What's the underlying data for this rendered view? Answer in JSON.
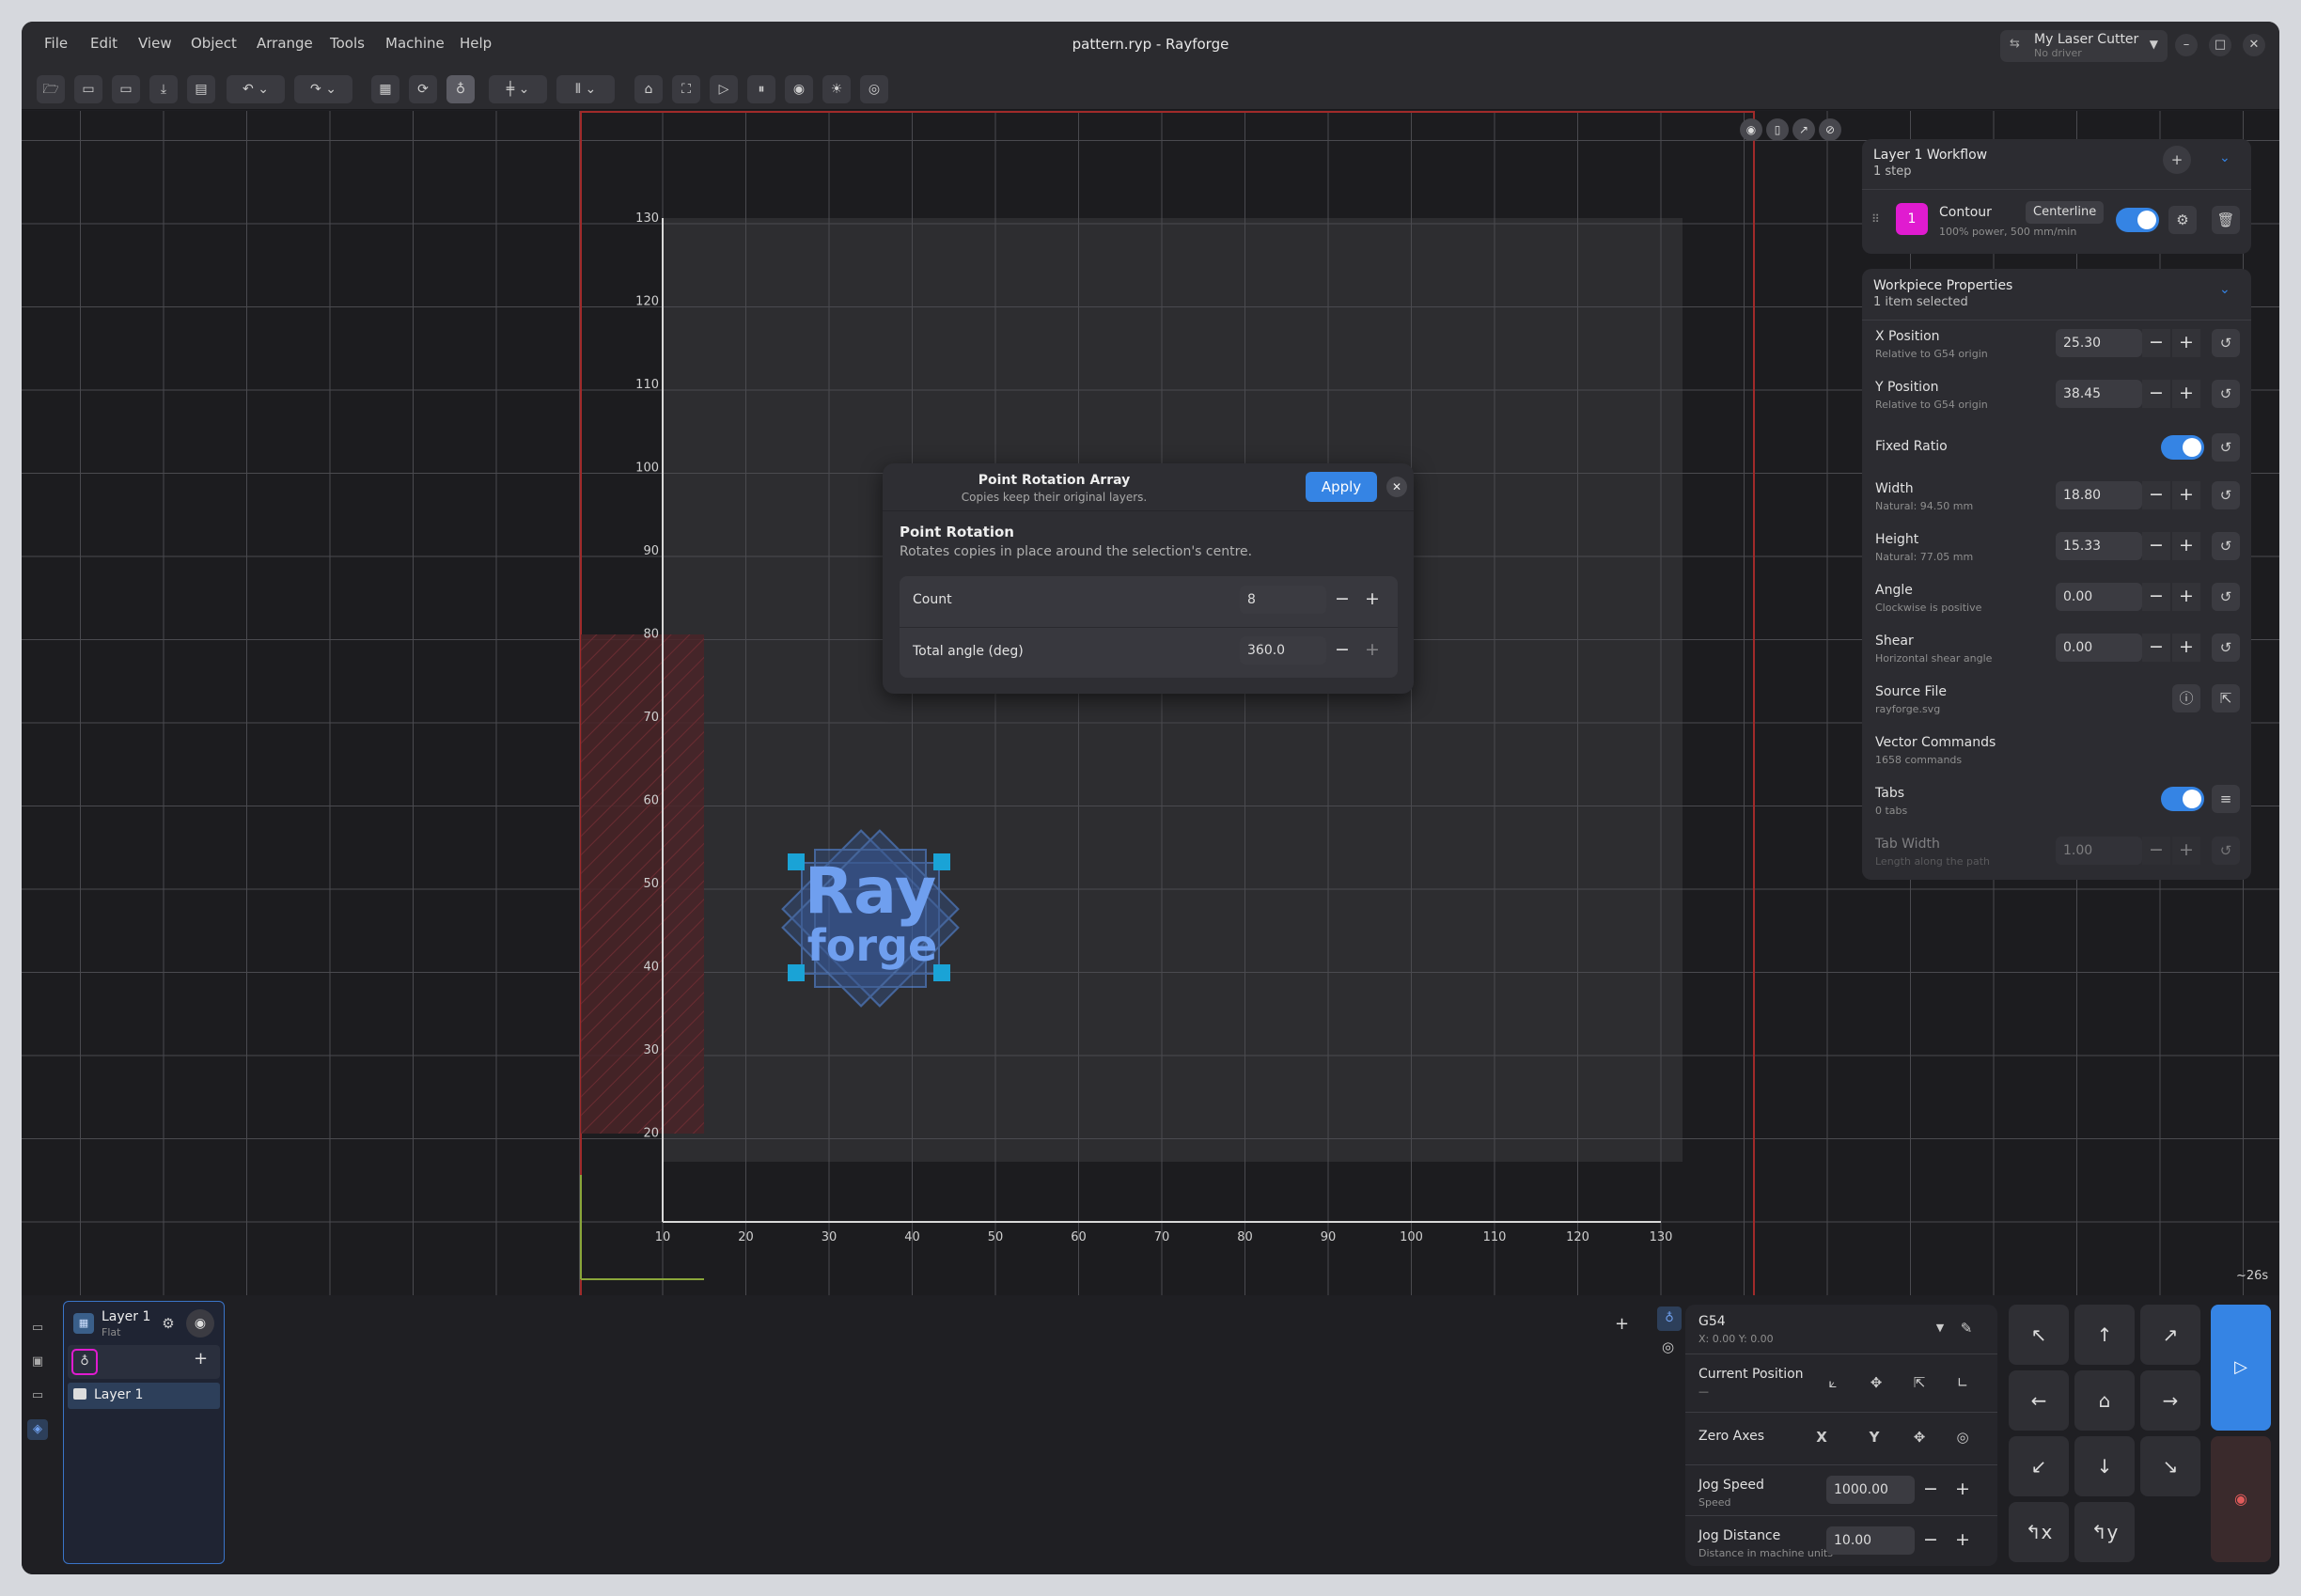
{
  "window": {
    "title": "pattern.ryp - Rayforge",
    "machine_name": "My Laser Cutter",
    "machine_driver": "No driver"
  },
  "menu": [
    "File",
    "Edit",
    "View",
    "Object",
    "Arrange",
    "Tools",
    "Machine",
    "Help"
  ],
  "toolbar_icons": [
    "open-icon",
    "save-icon",
    "save-as-icon",
    "import-icon",
    "export-icon",
    "undo-icon",
    "undo-menu-icon",
    "redo-icon",
    "redo-menu-icon",
    "gcode-icon",
    "refresh-icon",
    "travel-icon",
    "align-icon",
    "align-menu-icon",
    "distribute-icon",
    "distribute-menu-icon",
    "home-icon",
    "frame-icon",
    "send-icon",
    "pause-icon",
    "stop-icon",
    "focus-icon",
    "target-icon"
  ],
  "canvas": {
    "x_ticks": [
      "10",
      "20",
      "30",
      "40",
      "50",
      "60",
      "70",
      "80",
      "90",
      "100",
      "110",
      "120",
      "130"
    ],
    "y_ticks": [
      "130",
      "120",
      "110",
      "100",
      "90",
      "80",
      "70",
      "60",
      "50",
      "40",
      "30",
      "20"
    ],
    "time_estimate": "~26s",
    "logo_line1": "Ray",
    "logo_line2": "forge"
  },
  "workflow": {
    "title": "Layer 1 Workflow",
    "subtitle": "1 step",
    "step_number": "1",
    "step_name": "Contour",
    "step_badge": "Centerline",
    "step_detail": "100% power, 500 mm/min",
    "step_color": "#e01bd0"
  },
  "props": {
    "title": "Workpiece Properties",
    "subtitle": "1 item selected",
    "x_label": "X Position",
    "x_sub": "Relative to G54 origin",
    "x_val": "25.30",
    "y_label": "Y Position",
    "y_sub": "Relative to G54 origin",
    "y_val": "38.45",
    "ratio_label": "Fixed Ratio",
    "w_label": "Width",
    "w_sub": "Natural: 94.50 mm",
    "w_val": "18.80",
    "h_label": "Height",
    "h_sub": "Natural: 77.05 mm",
    "h_val": "15.33",
    "a_label": "Angle",
    "a_sub": "Clockwise is positive",
    "a_val": "0.00",
    "s_label": "Shear",
    "s_sub": "Horizontal shear angle",
    "s_val": "0.00",
    "src_label": "Source File",
    "src_sub": "rayforge.svg",
    "vec_label": "Vector Commands",
    "vec_sub": "1658 commands",
    "tabs_label": "Tabs",
    "tabs_sub": "0 tabs",
    "tw_label": "Tab Width",
    "tw_sub": "Length along the path",
    "tw_val": "1.00"
  },
  "dialog": {
    "title": "Point Rotation Array",
    "subtitle": "Copies keep their original layers.",
    "apply": "Apply",
    "section": "Point Rotation",
    "desc": "Rotates copies in place around the selection's centre.",
    "count_label": "Count",
    "count_val": "8",
    "angle_label": "Total angle (deg)",
    "angle_val": "360.0"
  },
  "layers": {
    "name": "Layer 1",
    "type": "Flat",
    "item": "Layer 1"
  },
  "control": {
    "wcs": "G54",
    "coords": "X: 0.00   Y: 0.00",
    "current_label": "Current Position",
    "current_sub": "—",
    "zero_label": "Zero Axes",
    "zero_x": "X",
    "zero_y": "Y",
    "speed_label": "Jog Speed",
    "speed_sub": "Speed",
    "speed_val": "1000.00",
    "dist_label": "Jog Distance",
    "dist_sub": "Distance in machine units",
    "dist_val": "10.00",
    "accent": "#3584e4"
  }
}
